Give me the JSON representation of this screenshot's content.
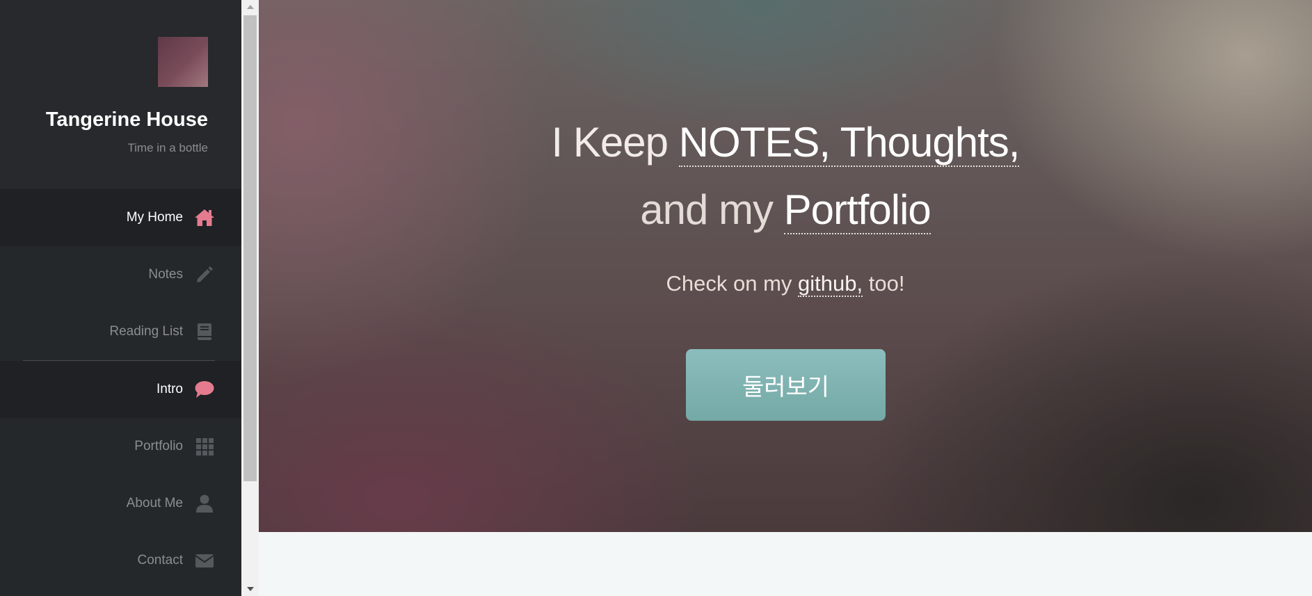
{
  "sidebar": {
    "title": "Tangerine House",
    "tagline": "Time in a bottle",
    "items": [
      {
        "label": "My Home",
        "icon": "home-icon"
      },
      {
        "label": "Notes",
        "icon": "pencil-icon"
      },
      {
        "label": "Reading List",
        "icon": "book-icon"
      },
      {
        "label": "Intro",
        "icon": "comment-icon"
      },
      {
        "label": "Portfolio",
        "icon": "grid-icon"
      },
      {
        "label": "About Me",
        "icon": "user-icon"
      },
      {
        "label": "Contact",
        "icon": "envelope-icon"
      }
    ]
  },
  "hero": {
    "line1_prefix": "I Keep ",
    "line1_link": "NOTES, Thoughts,",
    "line2_prefix": "and my ",
    "line2_link": "Portfolio",
    "sub_prefix": "Check on my ",
    "sub_link": "github,",
    "sub_suffix": " too!",
    "cta_label": "둘러보기"
  },
  "colors": {
    "accent": "#e57b8f",
    "sidebar_bg": "#25282b",
    "sidebar_active_bg": "#1f2124",
    "cta": "#7fb3b0"
  }
}
